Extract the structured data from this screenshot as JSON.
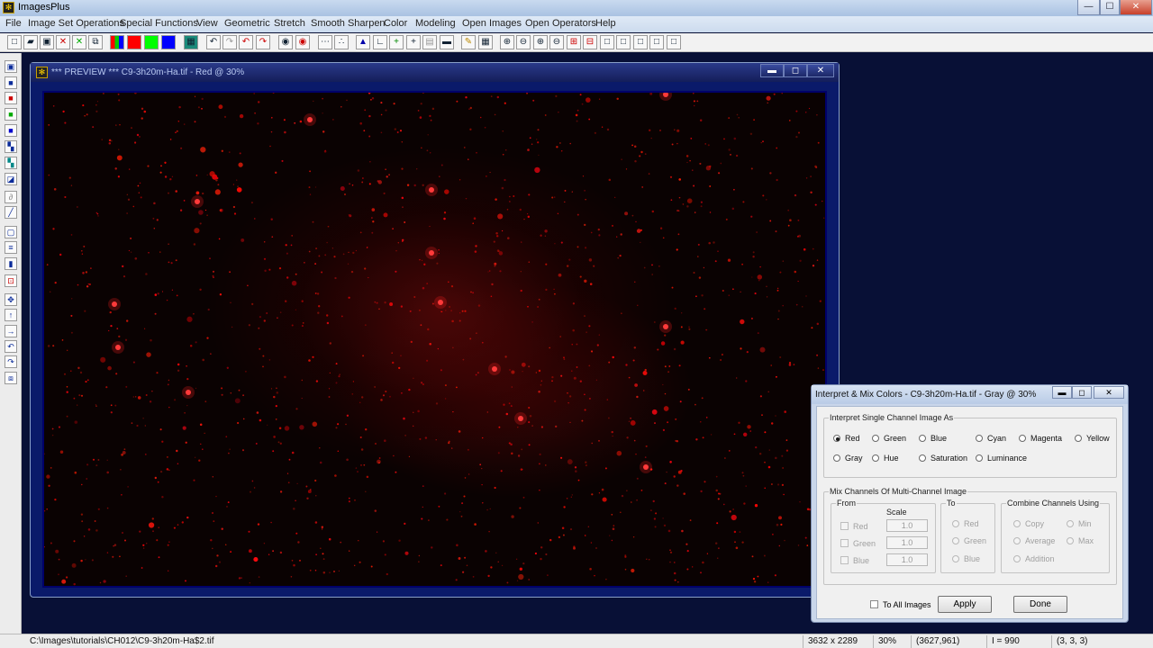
{
  "app": {
    "title": "ImagesPlus",
    "min": "—",
    "max": "☐",
    "close": "✕"
  },
  "menu": [
    "File",
    "Image Set Operations",
    "Special Functions",
    "View",
    "Geometric",
    "Stretch",
    "Smooth Sharpen",
    "Color",
    "Modeling",
    "Open Images",
    "Open Operators",
    "Help"
  ],
  "preview": {
    "title": "*** PREVIEW *** C9-3h20m-Ha.tif - Red @ 30%",
    "min": "▬",
    "max": "◻",
    "close": "✕"
  },
  "dialog": {
    "title": "Interpret & Mix Colors - C9-3h20m-Ha.tif - Gray @ 30%",
    "interpret_group": "Interpret Single Channel Image As",
    "interpret_options": [
      "Red",
      "Green",
      "Blue",
      "Cyan",
      "Magenta",
      "Yellow",
      "Gray",
      "Hue",
      "Saturation",
      "Luminance"
    ],
    "interpret_selected": "Red",
    "mix_group": "Mix Channels Of Multi-Channel Image",
    "from_label": "From",
    "scale_label": "Scale",
    "from_channels": [
      {
        "label": "Red",
        "scale": "1.0"
      },
      {
        "label": "Green",
        "scale": "1.0"
      },
      {
        "label": "Blue",
        "scale": "1.0"
      }
    ],
    "to_label": "To",
    "to_channels": [
      "Red",
      "Green",
      "Blue"
    ],
    "combine_label": "Combine Channels Using",
    "combine_options": [
      "Copy",
      "Min",
      "Average",
      "Max",
      "Addition"
    ],
    "to_all_images": "To All Images",
    "apply": "Apply",
    "done": "Done"
  },
  "status": {
    "path": "C:\\Images\\tutorials\\CH012\\C9-3h20m-Ha$2.tif",
    "dimensions": "3632 x 2289",
    "zoom": "30%",
    "cursor": "(3627,961)",
    "intensity": "I = 990",
    "sample": "(3, 3, 3)"
  }
}
